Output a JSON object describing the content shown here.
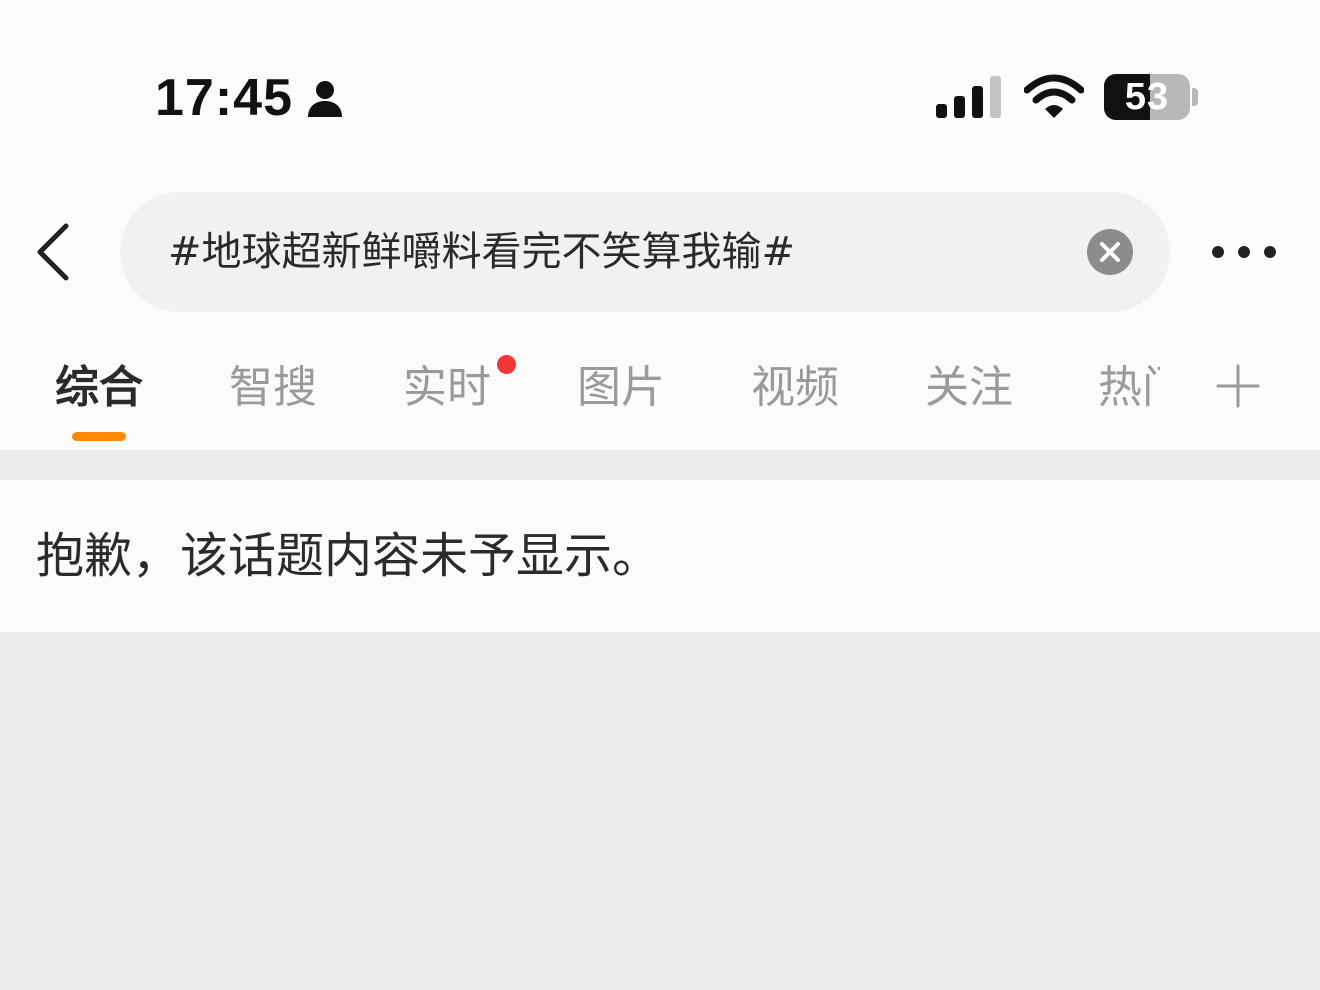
{
  "status_bar": {
    "time": "17:45",
    "battery_level": "53",
    "battery_percent": 53,
    "icons": [
      "person-icon",
      "signal-icon",
      "wifi-icon",
      "battery-icon"
    ]
  },
  "search": {
    "query": "#地球超新鲜嚼料看完不笑算我输#",
    "icons": [
      "back-icon",
      "clear-icon",
      "more-icon"
    ]
  },
  "tabs": [
    {
      "label": "综合",
      "active": true
    },
    {
      "label": "智搜"
    },
    {
      "label": "实时",
      "badge": "red-dot"
    },
    {
      "label": "图片"
    },
    {
      "label": "视频"
    },
    {
      "label": "关注"
    },
    {
      "label": "热门",
      "truncated": true
    }
  ],
  "add_tab_icon": "plus-icon",
  "message": "抱歉，该话题内容未予显示。",
  "colors": {
    "accent": "#ff8a00",
    "badge": "#f23535",
    "background": "#ececec",
    "surface": "#fbfbfb"
  }
}
